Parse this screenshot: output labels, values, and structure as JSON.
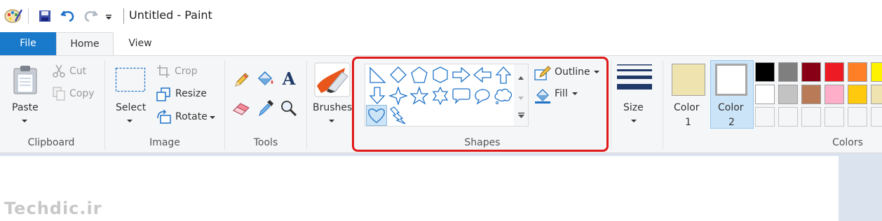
{
  "window": {
    "title": "Untitled - Paint"
  },
  "tabs": [
    {
      "label": "File"
    },
    {
      "label": "Home"
    },
    {
      "label": "View"
    }
  ],
  "clipboard": {
    "paste": "Paste",
    "cut": "Cut",
    "copy": "Copy",
    "group": "Clipboard"
  },
  "image": {
    "select": "Select",
    "crop": "Crop",
    "resize": "Resize",
    "rotate": "Rotate",
    "group": "Image"
  },
  "tools": {
    "group": "Tools"
  },
  "brushes": {
    "label": "Brushes"
  },
  "shapes": {
    "outline": "Outline",
    "fill": "Fill",
    "group": "Shapes"
  },
  "size": {
    "label": "Size"
  },
  "colors": {
    "color1_label": "Color",
    "color1_num": "1",
    "color2_label": "Color",
    "color2_num": "2",
    "group": "Colors",
    "color1": "#efe4b0",
    "color2": "#ffffff",
    "palette_row1": [
      "#000000",
      "#7f7f7f",
      "#880015",
      "#ed1c24",
      "#ff7f27",
      "#fff200"
    ],
    "palette_row2": [
      "#ffffff",
      "#c3c3c3",
      "#b97a57",
      "#ffaec9",
      "#ffc90e",
      "#efe4b0"
    ]
  },
  "watermark": "Techdic.ir"
}
